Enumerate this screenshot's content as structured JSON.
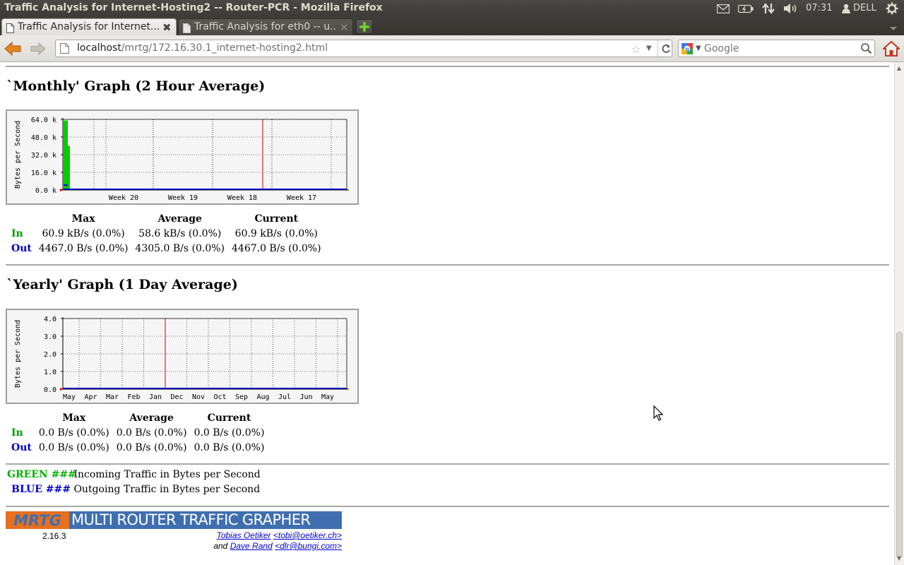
{
  "window": {
    "title": "Traffic Analysis for Internet-Hosting2 -- Router-PCR - Mozilla Firefox"
  },
  "system_panel": {
    "clock": "07:31",
    "user": "DELL"
  },
  "tabs": [
    {
      "label": "Traffic Analysis for Internet...",
      "active": true
    },
    {
      "label": "Traffic Analysis for eth0 -- u...",
      "active": false
    }
  ],
  "navigation": {
    "url_host": "localhost",
    "url_path": "/mrtg/172.16.30.1_internet-hosting2.html",
    "search_placeholder": "Google"
  },
  "monthly": {
    "heading": "`Monthly' Graph (2 Hour Average)",
    "chart_data": {
      "type": "area",
      "ylabel": "Bytes per Second",
      "y_ticks": [
        "0.0 k",
        "16.0 k",
        "32.0 k",
        "48.0 k",
        "64.0 k"
      ],
      "x_ticks": [
        "Week 20",
        "Week 19",
        "Week 18",
        "Week 17"
      ],
      "ylim": [
        0,
        64000
      ],
      "grid": true,
      "month_boundary_after": "Week 18",
      "series": [
        {
          "name": "In",
          "color": "#00cc00",
          "values": [
            63000,
            63000,
            40000,
            0,
            0,
            0,
            0,
            0,
            0,
            0
          ]
        },
        {
          "name": "Out",
          "color": "#0000ff",
          "values": [
            4467,
            4305,
            0,
            0,
            0,
            0,
            0,
            0,
            0,
            0
          ]
        }
      ]
    },
    "stats": {
      "headers": [
        "Max",
        "Average",
        "Current"
      ],
      "rows": [
        {
          "label": "In",
          "max": "60.9 kB/s (0.0%)",
          "average": "58.6 kB/s (0.0%)",
          "current": "60.9 kB/s (0.0%)"
        },
        {
          "label": "Out",
          "max": "4467.0 B/s (0.0%)",
          "average": "4305.0 B/s (0.0%)",
          "current": "4467.0 B/s (0.0%)"
        }
      ]
    }
  },
  "yearly": {
    "heading": "`Yearly' Graph (1 Day Average)",
    "chart_data": {
      "type": "area",
      "ylabel": "Bytes per Second",
      "y_ticks": [
        "0.0",
        "1.0",
        "2.0",
        "3.0",
        "4.0"
      ],
      "x_ticks": [
        "May",
        "Apr",
        "Mar",
        "Feb",
        "Jan",
        "Dec",
        "Nov",
        "Oct",
        "Sep",
        "Aug",
        "Jul",
        "Jun",
        "May"
      ],
      "ylim": [
        0,
        4
      ],
      "grid": true,
      "year_boundary_after": "Jan",
      "series": [
        {
          "name": "In",
          "color": "#00cc00",
          "values": [
            0,
            0,
            0,
            0,
            0,
            0,
            0,
            0,
            0,
            0,
            0,
            0,
            0
          ]
        },
        {
          "name": "Out",
          "color": "#0000ff",
          "values": [
            0,
            0,
            0,
            0,
            0,
            0,
            0,
            0,
            0,
            0,
            0,
            0,
            0
          ]
        }
      ]
    },
    "stats": {
      "headers": [
        "Max",
        "Average",
        "Current"
      ],
      "rows": [
        {
          "label": "In",
          "max": "0.0 B/s (0.0%)",
          "average": "0.0 B/s (0.0%)",
          "current": "0.0 B/s (0.0%)"
        },
        {
          "label": "Out",
          "max": "0.0 B/s (0.0%)",
          "average": "0.0 B/s (0.0%)",
          "current": "0.0 B/s (0.0%)"
        }
      ]
    }
  },
  "legend": [
    {
      "code": "GREEN ###",
      "text": "Incoming Traffic in Bytes per Second",
      "color": "#00b000"
    },
    {
      "code": "BLUE ###",
      "text": "Outgoing Traffic in Bytes per Second",
      "color": "#0000cc"
    }
  ],
  "footer": {
    "logo": "MRTG",
    "tagline": "MULTI ROUTER TRAFFIC GRAPHER",
    "version": "2.16.3",
    "author1_name": "Tobias Oetiker",
    "author1_email": "<tobi@oetiker.ch>",
    "and": "and",
    "author2_name": "Dave Rand",
    "author2_email": "<dlr@bungi.com>"
  }
}
